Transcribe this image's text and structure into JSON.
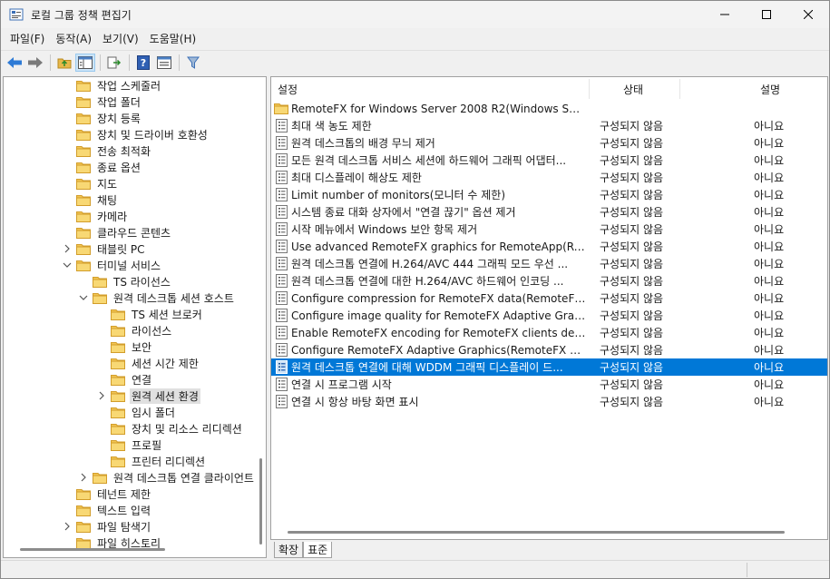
{
  "window": {
    "title": "로컬 그룹 정책 편집기"
  },
  "menu": [
    "파일(F)",
    "동작(A)",
    "보기(V)",
    "도움말(H)"
  ],
  "toolbar": [
    "back-icon",
    "forward-icon",
    "up-folder-icon",
    "show-hide-tree-icon",
    "export-list-icon",
    "help-icon",
    "properties-view-icon",
    "filter-icon"
  ],
  "tree": [
    {
      "label": "작업 스케줄러",
      "level": 0,
      "expander": "none"
    },
    {
      "label": "작업 폴더",
      "level": 0,
      "expander": "none"
    },
    {
      "label": "장치 등록",
      "level": 0,
      "expander": "none"
    },
    {
      "label": "장치 및 드라이버 호환성",
      "level": 0,
      "expander": "none"
    },
    {
      "label": "전송 최적화",
      "level": 0,
      "expander": "none"
    },
    {
      "label": "종료 옵션",
      "level": 0,
      "expander": "none"
    },
    {
      "label": "지도",
      "level": 0,
      "expander": "none"
    },
    {
      "label": "채팅",
      "level": 0,
      "expander": "none"
    },
    {
      "label": "카메라",
      "level": 0,
      "expander": "none"
    },
    {
      "label": "클라우드 콘텐츠",
      "level": 0,
      "expander": "none"
    },
    {
      "label": "태블릿 PC",
      "level": 0,
      "expander": "collapsed"
    },
    {
      "label": "터미널 서비스",
      "level": 0,
      "expander": "expanded"
    },
    {
      "label": "TS 라이선스",
      "level": 1,
      "expander": "none"
    },
    {
      "label": "원격 데스크톱 세션 호스트",
      "level": 1,
      "expander": "expanded"
    },
    {
      "label": "TS 세션 브로커",
      "level": 2,
      "expander": "none"
    },
    {
      "label": "라이선스",
      "level": 2,
      "expander": "none"
    },
    {
      "label": "보안",
      "level": 2,
      "expander": "none"
    },
    {
      "label": "세션 시간 제한",
      "level": 2,
      "expander": "none"
    },
    {
      "label": "연결",
      "level": 2,
      "expander": "none"
    },
    {
      "label": "원격 세션 환경",
      "level": 2,
      "expander": "collapsed",
      "selected": true
    },
    {
      "label": "임시 폴더",
      "level": 2,
      "expander": "none"
    },
    {
      "label": "장치 및 리소스 리디렉션",
      "level": 2,
      "expander": "none"
    },
    {
      "label": "프로필",
      "level": 2,
      "expander": "none"
    },
    {
      "label": "프린터 리디렉션",
      "level": 2,
      "expander": "none"
    },
    {
      "label": "원격 데스크톱 연결 클라이언트",
      "level": 1,
      "expander": "collapsed"
    },
    {
      "label": "테넌트 제한",
      "level": 0,
      "expander": "none"
    },
    {
      "label": "텍스트 입력",
      "level": 0,
      "expander": "none"
    },
    {
      "label": "파일 탐색기",
      "level": 0,
      "expander": "collapsed"
    },
    {
      "label": "파일 히스토리",
      "level": 0,
      "expander": "none"
    }
  ],
  "list": {
    "columns": [
      "설정",
      "상태",
      "설명"
    ],
    "rows": [
      {
        "name": "RemoteFX for Windows Server 2008 R2(Windows Server 2...",
        "state": "",
        "comment": "",
        "type": "folder"
      },
      {
        "name": "최대 색 농도 제한",
        "state": "구성되지 않음",
        "comment": "아니요",
        "type": "setting"
      },
      {
        "name": "원격 데스크톱의 배경 무늬 제거",
        "state": "구성되지 않음",
        "comment": "아니요",
        "type": "setting"
      },
      {
        "name": "모든 원격 데스크톱 서비스 세션에 하드웨어 그래픽 어댑터...",
        "state": "구성되지 않음",
        "comment": "아니요",
        "type": "setting"
      },
      {
        "name": "최대 디스플레이 해상도 제한",
        "state": "구성되지 않음",
        "comment": "아니요",
        "type": "setting"
      },
      {
        "name": "Limit number of monitors(모니터 수 제한)",
        "state": "구성되지 않음",
        "comment": "아니요",
        "type": "setting"
      },
      {
        "name": "시스템 종료 대화 상자에서 \"연결 끊기\" 옵션 제거",
        "state": "구성되지 않음",
        "comment": "아니요",
        "type": "setting"
      },
      {
        "name": "시작 메뉴에서 Windows 보안 항목 제거",
        "state": "구성되지 않음",
        "comment": "아니요",
        "type": "setting"
      },
      {
        "name": "Use advanced RemoteFX graphics for RemoteApp(Remote...",
        "state": "구성되지 않음",
        "comment": "아니요",
        "type": "setting"
      },
      {
        "name": "원격 데스크톱 연결에 H.264/AVC 444 그래픽 모드 우선 ...",
        "state": "구성되지 않음",
        "comment": "아니요",
        "type": "setting"
      },
      {
        "name": "원격 데스크톱 연결에 대한 H.264/AVC 하드웨어 인코딩 ...",
        "state": "구성되지 않음",
        "comment": "아니요",
        "type": "setting"
      },
      {
        "name": "Configure compression for RemoteFX data(RemoteFX 데이...",
        "state": "구성되지 않음",
        "comment": "아니요",
        "type": "setting"
      },
      {
        "name": "Configure image quality for RemoteFX Adaptive Graphics(...",
        "state": "구성되지 않음",
        "comment": "아니요",
        "type": "setting"
      },
      {
        "name": "Enable RemoteFX encoding for RemoteFX clients designed...",
        "state": "구성되지 않음",
        "comment": "아니요",
        "type": "setting"
      },
      {
        "name": "Configure RemoteFX Adaptive Graphics(RemoteFX 자동 그...",
        "state": "구성되지 않음",
        "comment": "아니요",
        "type": "setting"
      },
      {
        "name": "원격 데스크톱 연결에 대해 WDDM 그래픽 디스플레이 드...",
        "state": "구성되지 않음",
        "comment": "아니요",
        "type": "setting",
        "selected": true
      },
      {
        "name": "연결 시 프로그램 시작",
        "state": "구성되지 않음",
        "comment": "아니요",
        "type": "setting"
      },
      {
        "name": "연결 시 항상 바탕 화면 표시",
        "state": "구성되지 않음",
        "comment": "아니요",
        "type": "setting"
      }
    ]
  },
  "tabs": [
    {
      "label": "확장",
      "active": false
    },
    {
      "label": "표준",
      "active": true
    }
  ]
}
